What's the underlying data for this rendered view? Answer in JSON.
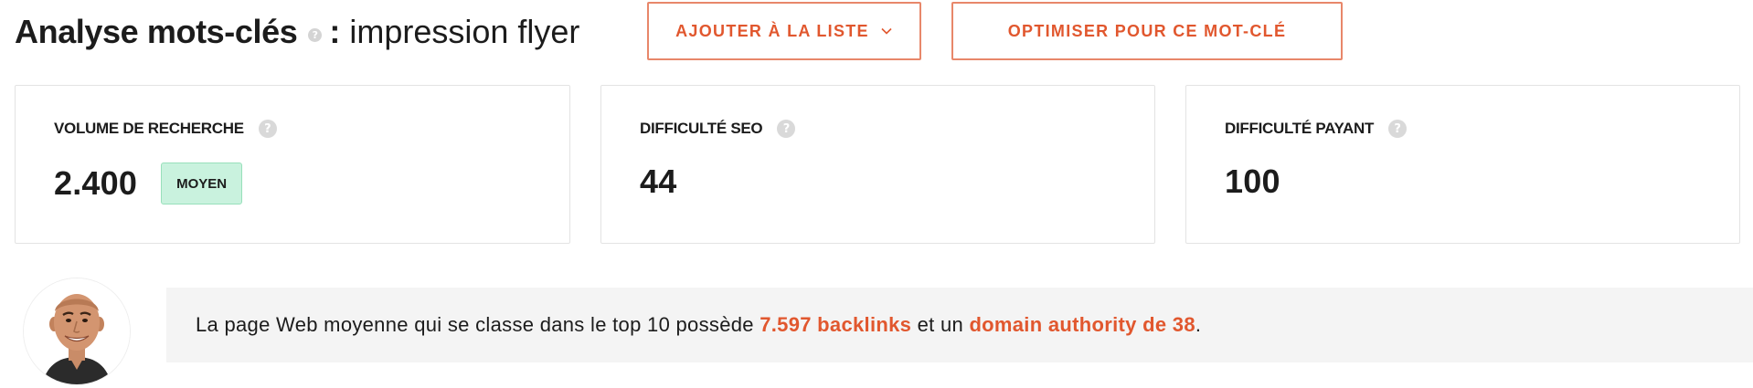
{
  "header": {
    "title": "Analyse mots-clés",
    "help_glyph": "?",
    "colon": ":",
    "keyword": "impression flyer"
  },
  "actions": {
    "add_to_list_label": "AJOUTER À LA LISTE",
    "optimize_label": "OPTIMISER POUR CE MOT-CLÉ",
    "chevron_icon": "chevron-down-icon"
  },
  "metrics": [
    {
      "label": "VOLUME DE RECHERCHE",
      "value": "2.400",
      "badge": "MOYEN",
      "badge_color": "#c9f2de"
    },
    {
      "label": "DIFFICULTÉ SEO",
      "value": "44"
    },
    {
      "label": "DIFFICULTÉ PAYANT",
      "value": "100"
    }
  ],
  "insight": {
    "prefix": "La page Web moyenne qui se classe dans le top 10 possède ",
    "backlinks": "7.597 backlinks",
    "middle": " et un ",
    "domain_authority": "domain authority de 38",
    "suffix": "."
  },
  "colors": {
    "accent": "#e1572e",
    "accent_border": "#e8876a",
    "card_border": "#e3e3e3",
    "insight_bg": "#f4f4f4"
  }
}
